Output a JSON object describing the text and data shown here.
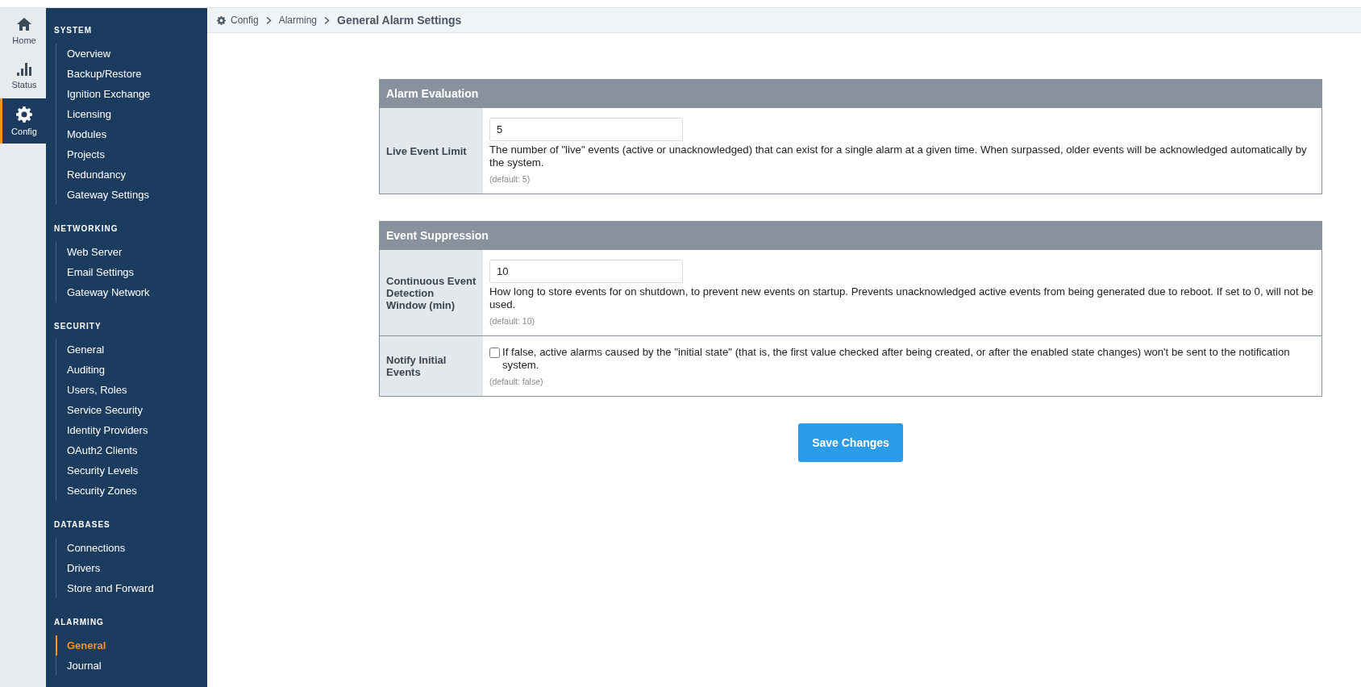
{
  "rail": [
    {
      "label": "Home",
      "selected": false
    },
    {
      "label": "Status",
      "selected": false
    },
    {
      "label": "Config",
      "selected": true
    }
  ],
  "sidebar": {
    "sections": [
      {
        "title": "SYSTEM",
        "items": [
          {
            "label": "Overview",
            "selected": false
          },
          {
            "label": "Backup/Restore",
            "selected": false
          },
          {
            "label": "Ignition Exchange",
            "selected": false
          },
          {
            "label": "Licensing",
            "selected": false
          },
          {
            "label": "Modules",
            "selected": false
          },
          {
            "label": "Projects",
            "selected": false
          },
          {
            "label": "Redundancy",
            "selected": false
          },
          {
            "label": "Gateway Settings",
            "selected": false
          }
        ]
      },
      {
        "title": "NETWORKING",
        "items": [
          {
            "label": "Web Server",
            "selected": false
          },
          {
            "label": "Email Settings",
            "selected": false
          },
          {
            "label": "Gateway Network",
            "selected": false
          }
        ]
      },
      {
        "title": "SECURITY",
        "items": [
          {
            "label": "General",
            "selected": false
          },
          {
            "label": "Auditing",
            "selected": false
          },
          {
            "label": "Users, Roles",
            "selected": false
          },
          {
            "label": "Service Security",
            "selected": false
          },
          {
            "label": "Identity Providers",
            "selected": false
          },
          {
            "label": "OAuth2 Clients",
            "selected": false
          },
          {
            "label": "Security Levels",
            "selected": false
          },
          {
            "label": "Security Zones",
            "selected": false
          }
        ]
      },
      {
        "title": "DATABASES",
        "items": [
          {
            "label": "Connections",
            "selected": false
          },
          {
            "label": "Drivers",
            "selected": false
          },
          {
            "label": "Store and Forward",
            "selected": false
          }
        ]
      },
      {
        "title": "ALARMING",
        "items": [
          {
            "label": "General",
            "selected": true
          },
          {
            "label": "Journal",
            "selected": false
          }
        ]
      }
    ]
  },
  "breadcrumb": [
    {
      "label": "Config"
    },
    {
      "label": "Alarming"
    },
    {
      "label": "General Alarm Settings"
    }
  ],
  "panels": [
    {
      "title": "Alarm Evaluation",
      "rows": [
        {
          "kind": "text",
          "label": "Live Event Limit",
          "value": "5",
          "description": "The number of \"live\" events (active or unacknowledged) that can exist for a single alarm at a given time. When surpassed, older events will be acknowledged automatically by the system.",
          "default": "(default: 5)"
        }
      ]
    },
    {
      "title": "Event Suppression",
      "rows": [
        {
          "kind": "text",
          "label": "Continuous Event Detection Window (min)",
          "value": "10",
          "description": "How long to store events for on shutdown, to prevent new events on startup. Prevents unacknowledged active events from being generated due to reboot. If set to 0, will not be used.",
          "default": "(default: 10)"
        },
        {
          "kind": "checkbox",
          "label": "Notify Initial Events",
          "checked": false,
          "description": "If false, active alarms caused by the \"initial state\" (that is, the first value checked after being created, or after the enabled state changes) won't be sent to the notification system.",
          "default": "(default: false)"
        }
      ]
    }
  ],
  "save_button": "Save Changes"
}
